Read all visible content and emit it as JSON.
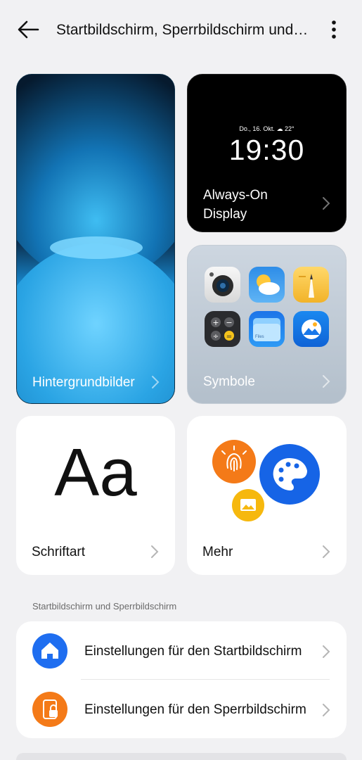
{
  "header": {
    "title": "Startbildschirm, Sperrbildschirm und Design",
    "back_icon": "back-arrow-icon",
    "more_icon": "more-vertical-icon"
  },
  "cards": {
    "wallpapers": {
      "label": "Hintergrundbilder"
    },
    "aod": {
      "label": "Always-On Display",
      "date": "Do., 16. Okt.",
      "weather": "22°",
      "time": "19:30"
    },
    "icons": {
      "label": "Symbole",
      "app_icons": [
        "camera-icon",
        "weather-icon",
        "notes-icon",
        "calculator-icon",
        "files-icon",
        "photos-icon"
      ],
      "files_text": "Files"
    },
    "font": {
      "label": "Schriftart",
      "sample": "Aa"
    },
    "more": {
      "label": "Mehr",
      "icons": [
        "fingerprint-icon",
        "palette-icon",
        "wallpaper-icon"
      ]
    }
  },
  "section": {
    "title": "Startbildschirm und Sperrbildschirm",
    "items": [
      {
        "label": "Einstellungen für den Startbildschirm",
        "icon": "home-icon",
        "color": "#1f6ef0"
      },
      {
        "label": "Einstellungen für den Sperrbildschirm",
        "icon": "lock-screen-icon",
        "color": "#f47a18"
      }
    ]
  },
  "colors": {
    "background": "#f1f1f3",
    "accent_blue": "#1f6ef0",
    "accent_orange": "#f47a18",
    "accent_yellow": "#f6b80e"
  }
}
